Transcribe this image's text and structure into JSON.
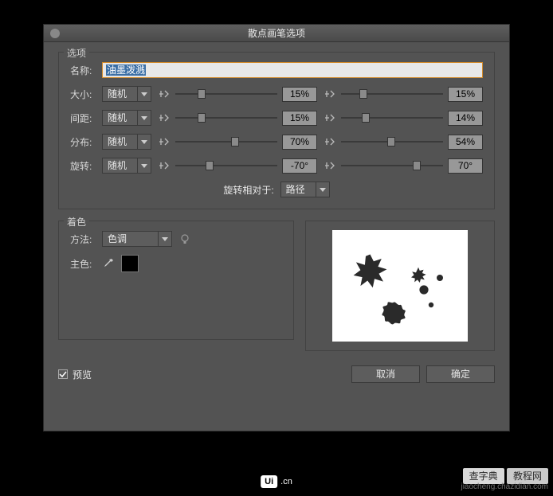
{
  "dialog": {
    "title": "散点画笔选项"
  },
  "options": {
    "legend": "选项",
    "name_label": "名称:",
    "name_value": "油墨泼溅",
    "rows": [
      {
        "label": "大小:",
        "mode": "随机",
        "val1": "15%",
        "val2": "15%",
        "thumb1": 22,
        "thumb2": 18
      },
      {
        "label": "间距:",
        "mode": "随机",
        "val1": "15%",
        "val2": "14%",
        "thumb1": 22,
        "thumb2": 20
      },
      {
        "label": "分布:",
        "mode": "随机",
        "val1": "70%",
        "val2": "54%",
        "thumb1": 55,
        "thumb2": 45
      },
      {
        "label": "旋转:",
        "mode": "随机",
        "val1": "-70°",
        "val2": "70°",
        "thumb1": 30,
        "thumb2": 70
      }
    ],
    "rotate_rel_label": "旋转相对于:",
    "rotate_rel_value": "路径"
  },
  "coloring": {
    "legend": "着色",
    "method_label": "方法:",
    "method_value": "色调",
    "key_color_label": "主色:",
    "key_color_hex": "#000000"
  },
  "footer": {
    "preview_label": "预览",
    "preview_checked": true,
    "cancel": "取消",
    "ok": "确定"
  },
  "watermark": {
    "brand1": "查字典",
    "brand2": "教程网",
    "url": "jiaocheng.chazidian.com",
    "ui_badge": "Ui",
    "ui_suffix": ".cn"
  }
}
